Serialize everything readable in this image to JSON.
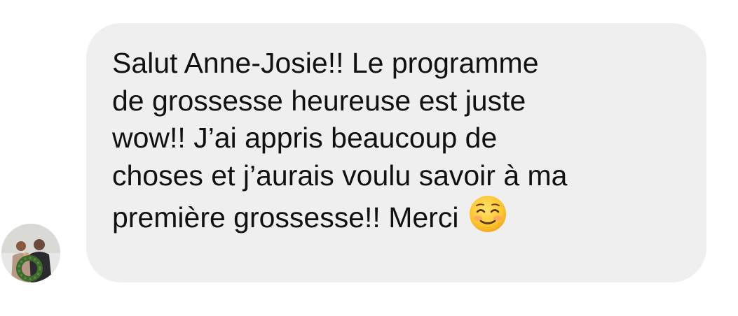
{
  "conversation": {
    "message": {
      "lines": [
        "Salut Anne-Josie!! Le programme",
        "de grossesse heureuse est juste",
        "wow!! J’ai appris beaucoup de",
        "choses et j’aurais voulu savoir à ma",
        "première grossesse!! Merci"
      ],
      "emoji": "smiling-face-with-smiling-eyes-emoji"
    },
    "sender": {
      "avatar_icon": "profile-photo-avatar"
    }
  },
  "colors": {
    "bubble_background": "#efefef",
    "text": "#111111",
    "page_background": "#ffffff"
  }
}
